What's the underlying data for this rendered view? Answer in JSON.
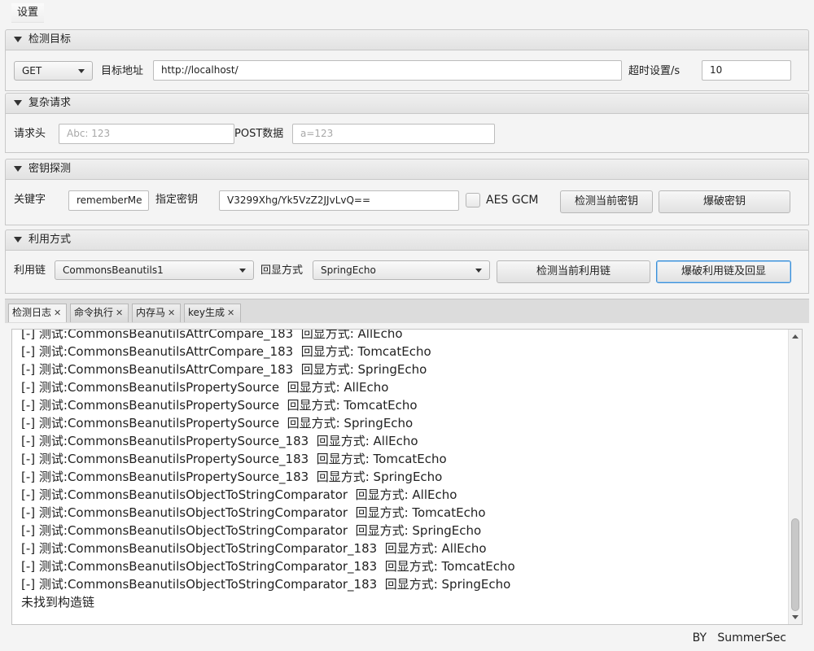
{
  "menubar": {
    "settings": "设置"
  },
  "target": {
    "title": "检测目标",
    "method": "GET",
    "url_label": "目标地址",
    "url_value": "http://localhost/",
    "timeout_label": "超时设置/s",
    "timeout_value": "10"
  },
  "complex": {
    "title": "复杂请求",
    "header_label": "请求头",
    "header_placeholder": "Abc: 123",
    "post_label": "POST数据",
    "post_placeholder": "a=123"
  },
  "key": {
    "title": "密钥探测",
    "keyword_label": "关键字",
    "keyword_value": "rememberMe",
    "specify_label": "指定密钥",
    "specify_value": "V3299Xhg/Yk5VzZ2JJvLvQ==",
    "aes_gcm_label": "AES GCM",
    "aes_gcm_checked": false,
    "check_button": "检测当前密钥",
    "brute_button": "爆破密钥"
  },
  "exploit": {
    "title": "利用方式",
    "chain_label": "利用链",
    "chain_value": "CommonsBeanutils1",
    "echo_label": "回显方式",
    "echo_value": "SpringEcho",
    "check_button": "检测当前利用链",
    "brute_button": "爆破利用链及回显"
  },
  "tabs": [
    {
      "label": "检测日志",
      "close": "✕"
    },
    {
      "label": "命令执行",
      "close": "✕"
    },
    {
      "label": "内存马",
      "close": "✕"
    },
    {
      "label": "key生成",
      "close": "✕"
    }
  ],
  "log": [
    "[-] 测试:CommonsBeanutilsAttrCompare_183  回显方式: AllEcho",
    "[-] 测试:CommonsBeanutilsAttrCompare_183  回显方式: TomcatEcho",
    "[-] 测试:CommonsBeanutilsAttrCompare_183  回显方式: SpringEcho",
    "[-] 测试:CommonsBeanutilsPropertySource  回显方式: AllEcho",
    "[-] 测试:CommonsBeanutilsPropertySource  回显方式: TomcatEcho",
    "[-] 测试:CommonsBeanutilsPropertySource  回显方式: SpringEcho",
    "[-] 测试:CommonsBeanutilsPropertySource_183  回显方式: AllEcho",
    "[-] 测试:CommonsBeanutilsPropertySource_183  回显方式: TomcatEcho",
    "[-] 测试:CommonsBeanutilsPropertySource_183  回显方式: SpringEcho",
    "[-] 测试:CommonsBeanutilsObjectToStringComparator  回显方式: AllEcho",
    "[-] 测试:CommonsBeanutilsObjectToStringComparator  回显方式: TomcatEcho",
    "[-] 测试:CommonsBeanutilsObjectToStringComparator  回显方式: SpringEcho",
    "[-] 测试:CommonsBeanutilsObjectToStringComparator_183  回显方式: AllEcho",
    "[-] 测试:CommonsBeanutilsObjectToStringComparator_183  回显方式: TomcatEcho",
    "[-] 测试:CommonsBeanutilsObjectToStringComparator_183  回显方式: SpringEcho",
    "未找到构造链"
  ],
  "footer": "BY   SummerSec"
}
